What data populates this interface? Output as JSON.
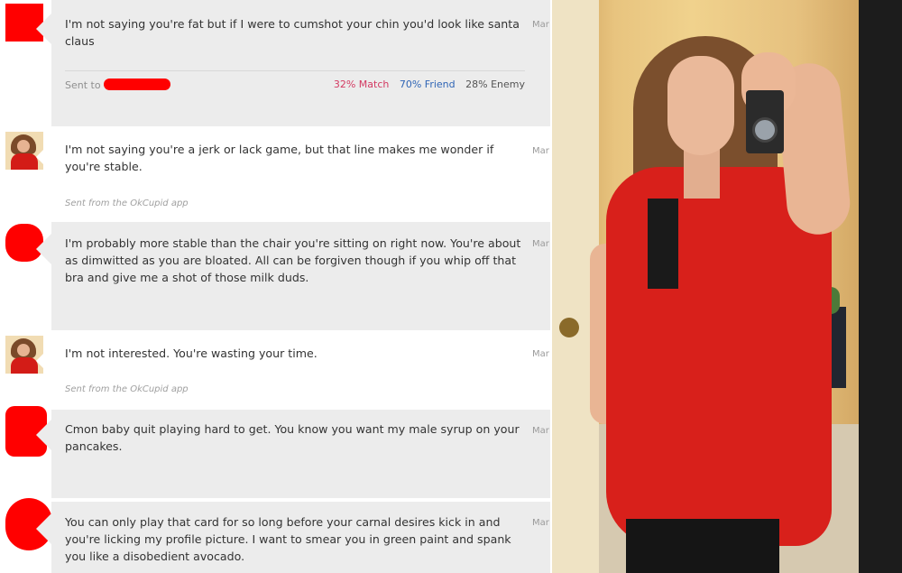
{
  "messages": [
    {
      "text": "I'm not saying you're fat but if I were to cumshot your chin you'd look like santa claus",
      "date": "Mar",
      "sent_to_label": "Sent to",
      "match": "32% Match",
      "friend": "70% Friend",
      "enemy": "28% Enemy"
    },
    {
      "text": "I'm not saying you're a jerk or lack game, but that line makes me wonder if you're stable.",
      "date": "Mar",
      "footer": "Sent from the OkCupid app"
    },
    {
      "text": "I'm probably more stable than the chair you're sitting on right now. You're about as dimwitted as you are bloated. All can be forgiven though if you whip off that bra and give me a shot of those milk duds.",
      "date": "Mar"
    },
    {
      "text": "I'm not interested. You're wasting your time.",
      "date": "Mar",
      "footer": "Sent from the OkCupid app"
    },
    {
      "text": "Cmon baby quit playing hard to get. You know you want my male syrup on your pancakes.",
      "date": "Mar"
    },
    {
      "text": "You can only play that card for so long before your carnal desires kick in and you're licking my profile picture. I want to smear you in green paint and spank you like a disobedient avocado.",
      "date": "Mar"
    }
  ],
  "colors": {
    "redaction": "#ff0000",
    "match": "#d33a62",
    "friend": "#2f65b5",
    "bubble_grey": "#ececec"
  }
}
